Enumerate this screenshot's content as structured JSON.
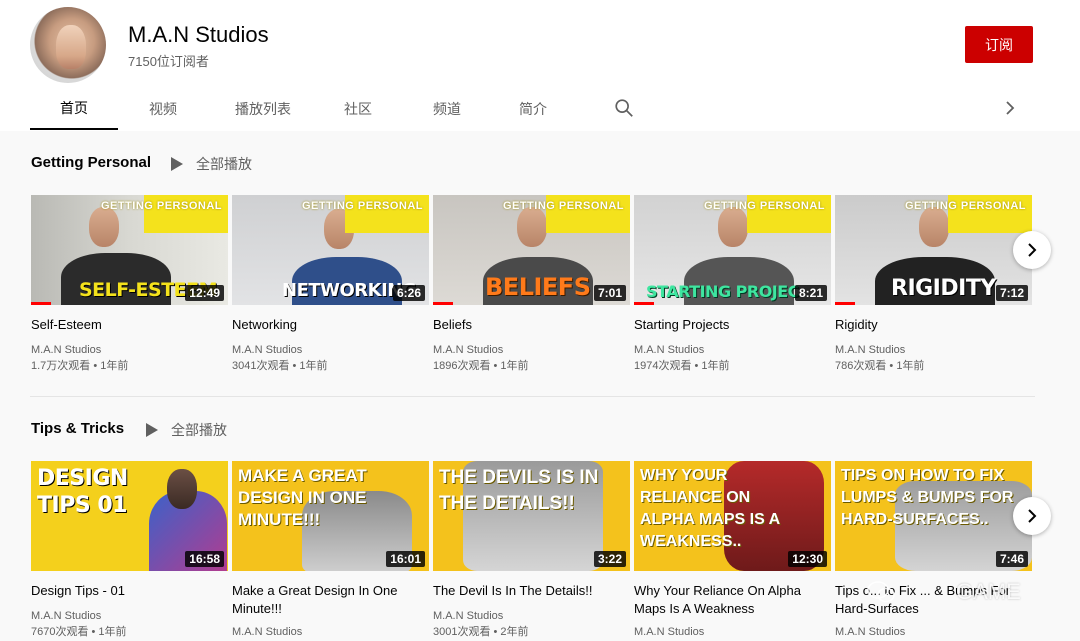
{
  "channel": {
    "name": "M.A.N Studios",
    "subscribers": "7150位订阅者",
    "subscribe_label": "订阅"
  },
  "tabs": [
    {
      "label": "首页"
    },
    {
      "label": "视频"
    },
    {
      "label": "播放列表"
    },
    {
      "label": "社区"
    },
    {
      "label": "频道"
    },
    {
      "label": "简介"
    }
  ],
  "icons": {
    "search": "search-icon",
    "tab_scroll": "chevron-right-icon",
    "play": "play-icon",
    "carousel_next": "chevron-right-icon",
    "watermark": "wechat-icon"
  },
  "colors": {
    "subscribe": "#cc0000",
    "progress": "#ff0000",
    "thumb_yellow": "#f4e21c"
  },
  "sections": [
    {
      "title": "Getting Personal",
      "play_all": "全部播放",
      "videos": [
        {
          "title": "Self-Esteem",
          "channel": "M.A.N Studios",
          "stats": "1.7万次观看 • 1年前",
          "duration": "12:49",
          "overlay": "SELF-ESTEEM",
          "badge": "GETTING PERSONAL",
          "watched": 0.1
        },
        {
          "title": "Networking",
          "channel": "M.A.N Studios",
          "stats": "3041次观看 • 1年前",
          "duration": "6:26",
          "overlay": "NETWORKING",
          "badge": "GETTING PERSONAL",
          "watched": 0
        },
        {
          "title": "Beliefs",
          "channel": "M.A.N Studios",
          "stats": "1896次观看 • 1年前",
          "duration": "7:01",
          "overlay": "BELIEFS",
          "badge": "GETTING PERSONAL",
          "watched": 0.1
        },
        {
          "title": "Starting Projects",
          "channel": "M.A.N Studios",
          "stats": "1974次观看 • 1年前",
          "duration": "8:21",
          "overlay": "STARTING PROJEC",
          "badge": "GETTING PERSONAL",
          "watched": 0.1
        },
        {
          "title": "Rigidity",
          "channel": "M.A.N Studios",
          "stats": "786次观看 • 1年前",
          "duration": "7:12",
          "overlay": "RIGIDITY",
          "badge": "GETTING PERSONAL",
          "watched": 0.1
        }
      ]
    },
    {
      "title": "Tips & Tricks",
      "play_all": "全部播放",
      "videos": [
        {
          "title": "Design Tips - 01",
          "channel": "M.A.N Studios",
          "stats": "7670次观看 • 1年前",
          "duration": "16:58",
          "overlay": "DESIGN TIPS 01"
        },
        {
          "title": "Make a Great Design In One Minute!!!",
          "channel": "M.A.N Studios",
          "stats": "",
          "duration": "16:01",
          "overlay": "MAKE A GREAT DESIGN IN ONE MINUTE!!!"
        },
        {
          "title": "The Devil Is In The Details!!",
          "channel": "M.A.N Studios",
          "stats": "3001次观看 • 2年前",
          "duration": "3:22",
          "overlay": "THE DEVILS IS IN THE DETAILS!!"
        },
        {
          "title": "Why Your Reliance On Alpha Maps Is A Weakness",
          "channel": "M.A.N Studios",
          "stats": "",
          "duration": "12:30",
          "overlay": "WHY YOUR RELIANCE ON ALPHA MAPS IS A WEAKNESS.."
        },
        {
          "title": "Tips on How to Fix Lumps & Bumps For Hard-Surfaces",
          "title_visible": "Tips o... to Fix ... & Bumps For Hard-Surfaces",
          "channel": "M.A.N Studios",
          "stats": "",
          "duration": "7:46",
          "overlay": "TIPS ON HOW TO FIX LUMPS & BUMPS FOR HARD-SURFACES.."
        }
      ]
    }
  ],
  "watermark": {
    "text": "GAME"
  }
}
